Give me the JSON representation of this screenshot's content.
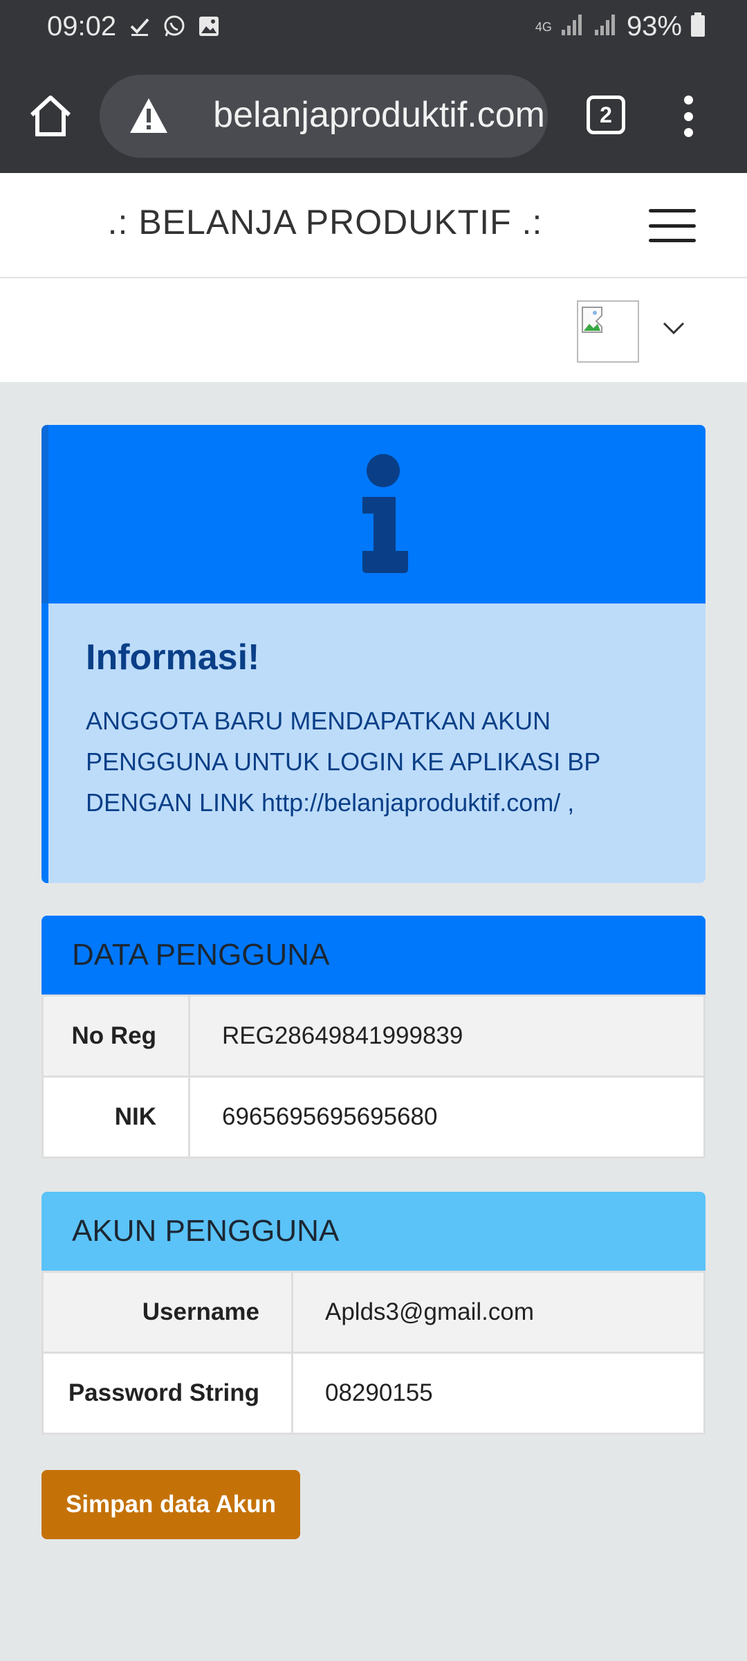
{
  "status_bar": {
    "time": "09:02",
    "network": "4G",
    "battery": "93%"
  },
  "browser": {
    "url": "belanjaproduktif.com",
    "tab_count": "2"
  },
  "site": {
    "brand": ".: BELANJA PRODUKTIF .:"
  },
  "info": {
    "title": "Informasi!",
    "message": "ANGGOTA BARU MENDAPATKAN AKUN PENGGUNA UNTUK LOGIN KE APLIKASI BP DENGAN LINK http://belanjaproduktif.com/ ,"
  },
  "data_pengguna": {
    "heading": "DATA PENGGUNA",
    "rows": [
      {
        "label": "No Reg",
        "value": "REG28649841999839"
      },
      {
        "label": "NIK",
        "value": "6965695695695680"
      }
    ]
  },
  "akun_pengguna": {
    "heading": "AKUN PENGGUNA",
    "rows": [
      {
        "label": "Username",
        "value": "Aplds3@gmail.com"
      },
      {
        "label": "Password String",
        "value": "08290155"
      }
    ]
  },
  "actions": {
    "save_label": "Simpan data Akun"
  },
  "colors": {
    "primary": "#0078fc",
    "info_bg": "#bddcfa",
    "info_text": "#0a3f87",
    "accent_header": "#5bc3f8",
    "button": "#c47208"
  }
}
